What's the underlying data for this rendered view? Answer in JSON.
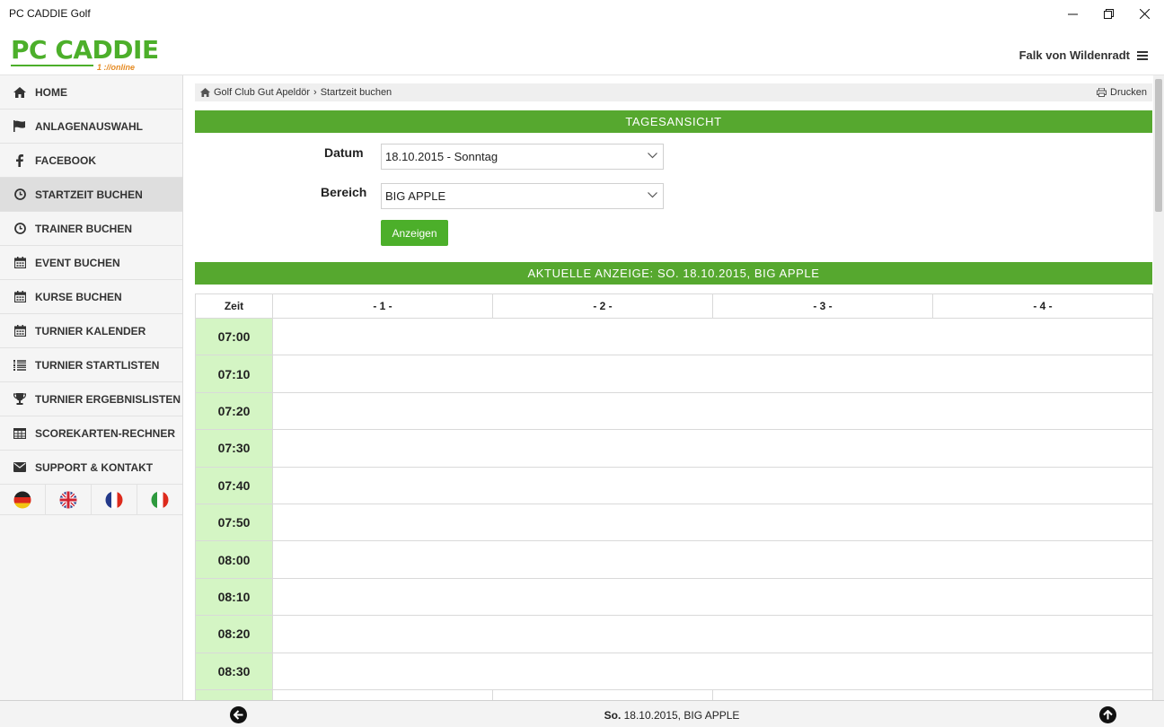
{
  "window": {
    "title": "PC CADDIE Golf"
  },
  "header": {
    "logo_main": "PC CADDIE",
    "logo_sub": "1 ://online",
    "user_name": "Falk von Wildenradt"
  },
  "sidebar": {
    "items": [
      {
        "label": "HOME",
        "icon": "home-icon"
      },
      {
        "label": "ANLAGENAUSWAHL",
        "icon": "flag-icon"
      },
      {
        "label": "FACEBOOK",
        "icon": "facebook-icon"
      },
      {
        "label": "STARTZEIT BUCHEN",
        "icon": "clock-icon",
        "active": true
      },
      {
        "label": "TRAINER BUCHEN",
        "icon": "clock-icon"
      },
      {
        "label": "EVENT BUCHEN",
        "icon": "calendar-icon"
      },
      {
        "label": "KURSE BUCHEN",
        "icon": "calendar-icon"
      },
      {
        "label": "TURNIER KALENDER",
        "icon": "calendar-icon"
      },
      {
        "label": "TURNIER STARTLISTEN",
        "icon": "list-icon"
      },
      {
        "label": "TURNIER ERGEBNISLISTEN",
        "icon": "trophy-icon"
      },
      {
        "label": "SCOREKARTEN-RECHNER",
        "icon": "table-icon"
      },
      {
        "label": "SUPPORT & KONTAKT",
        "icon": "envelope-icon"
      }
    ],
    "flags": [
      "german-flag-icon",
      "uk-flag-icon",
      "french-flag-icon",
      "italian-flag-icon"
    ]
  },
  "breadcrumb": {
    "club": "Golf Club Gut Apeldör",
    "page": "Startzeit buchen",
    "print_label": "Drucken"
  },
  "tagesansicht": {
    "heading": "TAGESANSICHT",
    "datum_label": "Datum",
    "datum_value": "18.10.2015 - Sonntag",
    "bereich_label": "Bereich",
    "bereich_value": "BIG APPLE",
    "show_button": "Anzeigen"
  },
  "grid": {
    "heading": "AKTUELLE ANZEIGE: SO. 18.10.2015, BIG APPLE",
    "col_time": "Zeit",
    "columns": [
      "- 1 -",
      "- 2 -",
      "- 3 -",
      "- 4 -"
    ],
    "times": [
      "07:00",
      "07:10",
      "07:20",
      "07:30",
      "07:40",
      "07:50",
      "08:00",
      "08:10",
      "08:20",
      "08:30"
    ]
  },
  "footer": {
    "day": "So.",
    "date_area": "18.10.2015, BIG APPLE"
  },
  "colors": {
    "brand_green": "#4caf2a",
    "bar_green": "#56a82f",
    "time_cell": "#d4f5c4",
    "logo_orange": "#e58a22"
  }
}
